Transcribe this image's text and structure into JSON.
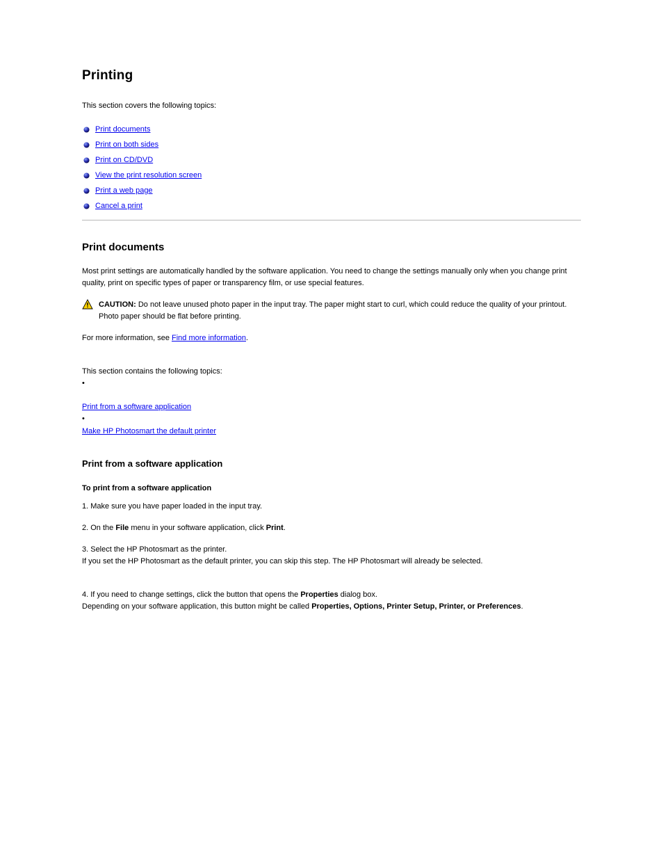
{
  "title": "Printing",
  "intro": "This section covers the following topics:",
  "toc": [
    "Print documents",
    "Print on both sides",
    "Print on CD/DVD",
    "View the print resolution screen",
    "Print a web page",
    "Cancel a print"
  ],
  "section1": {
    "heading": "Print documents",
    "p1": "Most print settings are automatically handled by the software application. You need to change the settings manually only when you change print quality, print on specific types of paper or transparency film, or use special features.",
    "caution_label": "CAUTION:",
    "caution_text": " Do not leave unused photo paper in the input tray. The paper might start to curl, which could reduce the quality of your printout. Photo paper should be flat before printing.",
    "p2_before": "For more information, see ",
    "p2_link": "Find more information",
    "p2_after": ".",
    "p3_before": "This section contains the following topics:\n•\n\n",
    "p3_link1": "Print from a software application",
    "p3_mid": "\n•\n",
    "p3_link2": "Make HP Photosmart the default printer",
    "subheading": "Print from a software application",
    "step_heading": "To print from a software application",
    "step1": "1. Make sure you have paper loaded in the input tray.",
    "step2_before": "2. On the ",
    "step2_bold1": "File",
    "step2_mid1": " menu in your software application, click ",
    "step2_bold2": "Print",
    "step2_after": ".",
    "step3": "3. Select the HP Photosmart as the printer.\nIf you set the HP Photosmart as the default printer, you can skip this step. The HP Photosmart will already be selected.",
    "step4_before": "4. If you need to change settings, click the button that opens the ",
    "step4_bold": "Properties",
    "step4_mid": " dialog box.\nDepending on your software application, this button might be called ",
    "step4_list": "Properties, Options, Printer Setup, Printer, or Preferences",
    "step4_after": "."
  }
}
